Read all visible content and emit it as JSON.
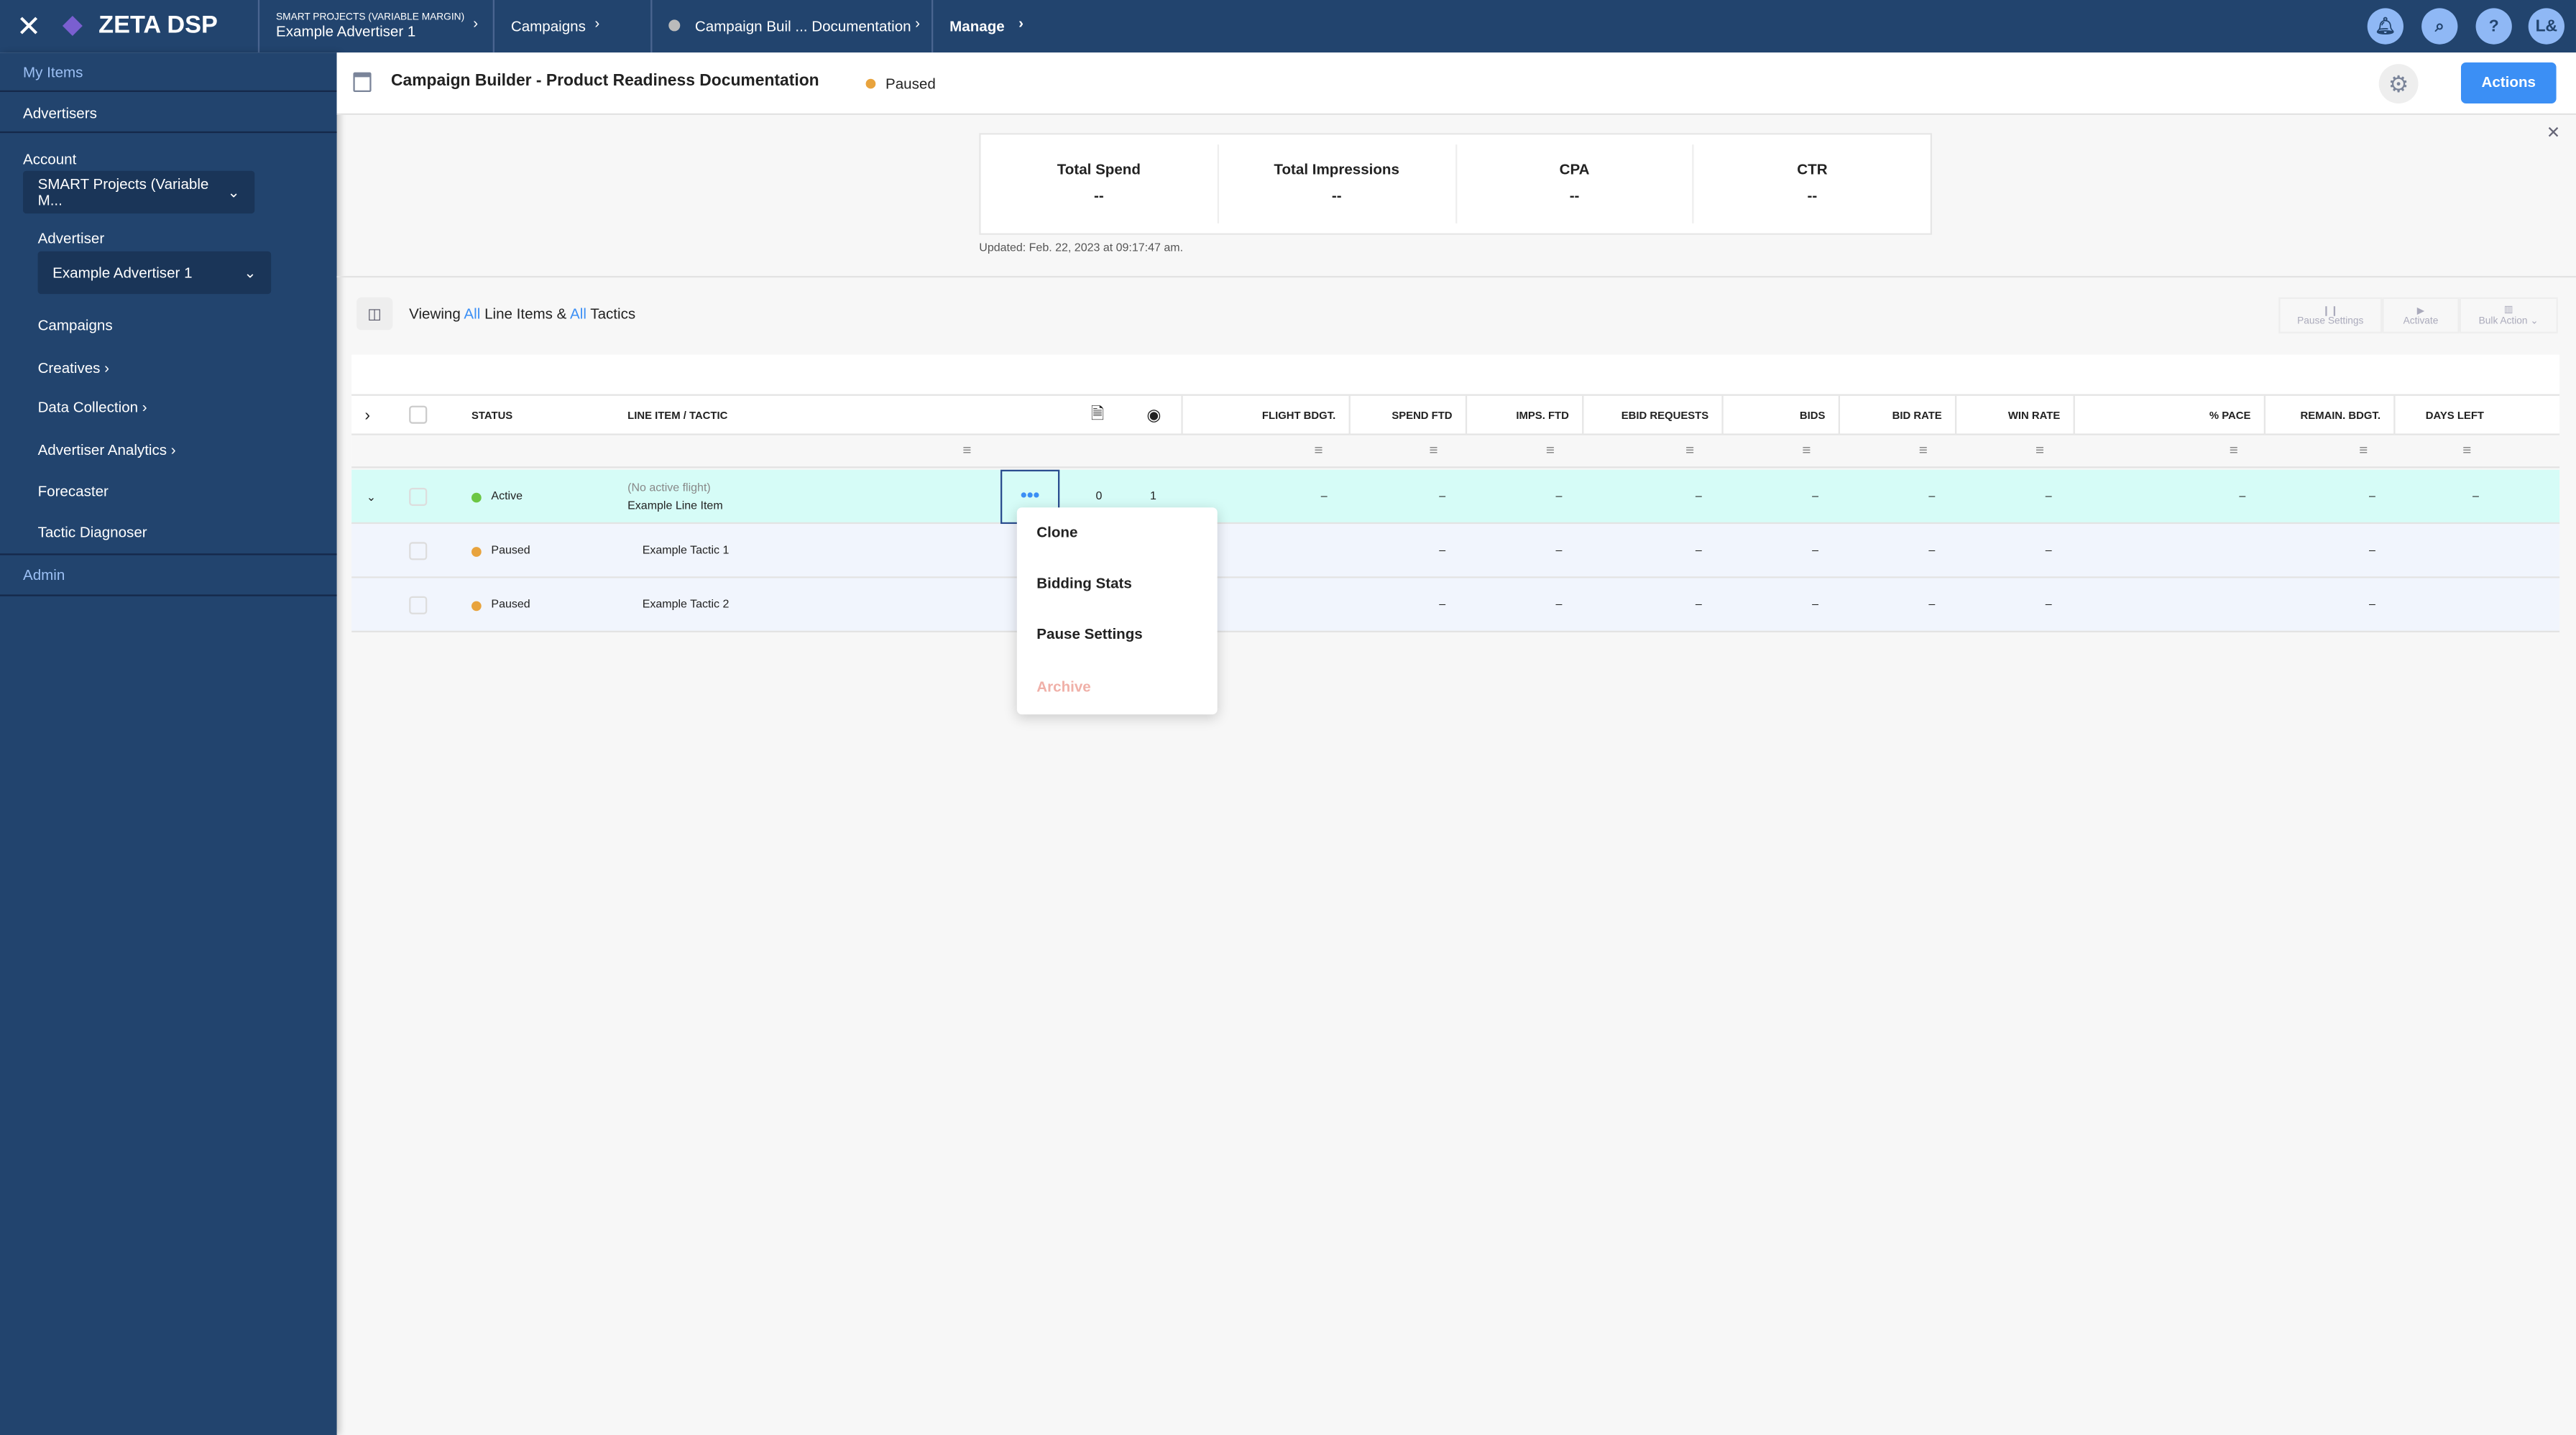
{
  "topbar": {
    "brand": "ZETA DSP",
    "crumbs": [
      {
        "sup": "SMART PROJECTS (VARIABLE MARGIN)",
        "label": "Example Advertiser 1"
      },
      {
        "label": "Campaigns"
      },
      {
        "label": "Campaign Buil ... Documentation"
      },
      {
        "label": "Manage"
      }
    ],
    "avatar": "L&"
  },
  "sidebar": {
    "my_items": "My Items",
    "advertisers": "Advertisers",
    "account_label": "Account",
    "account_value": "SMART Projects (Variable M...",
    "advertiser_label": "Advertiser",
    "advertiser_value": "Example Advertiser 1",
    "items": [
      "Campaigns",
      "Creatives",
      "Data Collection",
      "Advertiser Analytics",
      "Forecaster",
      "Tactic Diagnoser"
    ],
    "admin": "Admin"
  },
  "header": {
    "title": "Campaign Builder - Product Readiness Documentation",
    "status": "Paused",
    "actions": "Actions"
  },
  "stats": {
    "items": [
      {
        "label": "Total Spend",
        "value": "--"
      },
      {
        "label": "Total Impressions",
        "value": "--"
      },
      {
        "label": "CPA",
        "value": "--"
      },
      {
        "label": "CTR",
        "value": "--"
      }
    ],
    "updated": "Updated: Feb. 22, 2023 at 09:17:47 am."
  },
  "viewing": {
    "prefix": "Viewing",
    "all1": "All",
    "mid": "Line Items &",
    "all2": "All",
    "suffix": "Tactics"
  },
  "toolbar": {
    "pause": "Pause Settings",
    "activate": "Activate",
    "bulk": "Bulk Action"
  },
  "columns": {
    "status": "STATUS",
    "line_item": "LINE ITEM / TACTIC",
    "flight": "FLIGHT BDGT.",
    "spend": "SPEND FTD",
    "imps": "IMPS. FTD",
    "ebid": "EBID REQUESTS",
    "bids": "BIDS",
    "bid_rate": "BID RATE",
    "win_rate": "WIN RATE",
    "pace": "% PACE",
    "remain": "REMAIN. BDGT.",
    "days": "DAYS LEFT"
  },
  "rows": [
    {
      "status": "Active",
      "sub": "(No active flight)",
      "name": "Example Line Item",
      "creatives": "0",
      "tactics": "1",
      "flight": "–",
      "spend": "–",
      "imps": "–",
      "ebid": "–",
      "bids": "–",
      "bid_rate": "–",
      "win_rate": "–",
      "pace": "–",
      "remain": "–",
      "days": "–"
    },
    {
      "status": "Paused",
      "name": "Example Tactic 1",
      "spend": "–",
      "imps": "–",
      "ebid": "–",
      "bids": "–",
      "bid_rate": "–",
      "win_rate": "–",
      "remain": "–"
    },
    {
      "status": "Paused",
      "name": "Example Tactic 2",
      "spend": "–",
      "imps": "–",
      "ebid": "–",
      "bids": "–",
      "bid_rate": "–",
      "win_rate": "–",
      "remain": "–"
    }
  ],
  "menu": {
    "items": [
      "Clone",
      "Bidding Stats",
      "Pause Settings",
      "Archive"
    ]
  },
  "colors": {
    "nav": "#22446e",
    "accent": "#3b8ff5",
    "active": "#6cc644",
    "paused": "#e8a33d",
    "row_active": "#d6fcf7"
  }
}
